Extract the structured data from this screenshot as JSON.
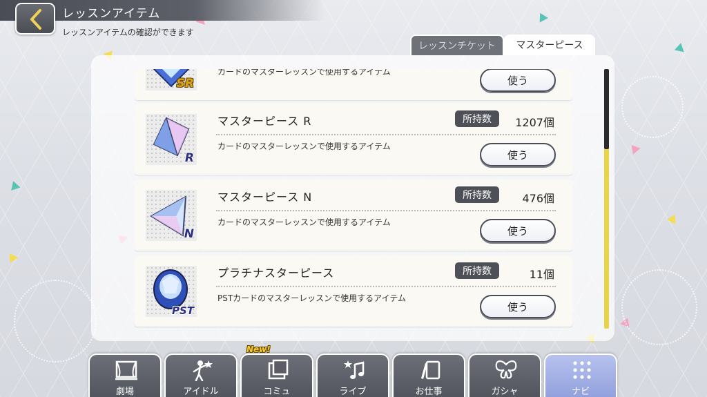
{
  "header": {
    "title": "レッスンアイテム",
    "subtitle": "レッスンアイテムの確認ができます"
  },
  "tabs": [
    {
      "label": "レッスンチケット",
      "active": false
    },
    {
      "label": "マスターピース",
      "active": true
    }
  ],
  "items": [
    {
      "name": "",
      "rank": "SR",
      "owned_label": "",
      "count": "",
      "description": "カードのマスターレッスンで使用するアイテム",
      "use_label": "使う",
      "gem_color": "#3f63c9"
    },
    {
      "name": "マスターピース R",
      "rank": "R",
      "owned_label": "所持数",
      "count": "1207個",
      "description": "カードのマスターレッスンで使用するアイテム",
      "use_label": "使う",
      "gem_color": "#5a7fd6"
    },
    {
      "name": "マスターピース N",
      "rank": "N",
      "owned_label": "所持数",
      "count": "476個",
      "description": "カードのマスターレッスンで使用するアイテム",
      "use_label": "使う",
      "gem_color": "#7b8fe0"
    },
    {
      "name": "プラチナスターピース",
      "rank": "PST",
      "owned_label": "所持数",
      "count": "11個",
      "description": "PSTカードのマスターレッスンで使用するアイテム",
      "use_label": "使う",
      "gem_color": "#2f4fb8"
    }
  ],
  "nav": [
    {
      "label": "劇場",
      "icon": "theater-icon",
      "active": false
    },
    {
      "label": "アイドル",
      "icon": "idol-icon",
      "active": false
    },
    {
      "label": "コミュ",
      "icon": "commu-icon",
      "active": false,
      "badge": "New!"
    },
    {
      "label": "ライブ",
      "icon": "music-note-icon",
      "active": false
    },
    {
      "label": "お仕事",
      "icon": "work-icon",
      "active": false
    },
    {
      "label": "ガシャ",
      "icon": "butterfly-icon",
      "active": false
    },
    {
      "label": "ナビ",
      "icon": "grid-dots-icon",
      "active": true
    }
  ],
  "colors": {
    "accent": "#e8d34a",
    "dark": "#4e5057",
    "nav_active": "#9aa8e2"
  }
}
